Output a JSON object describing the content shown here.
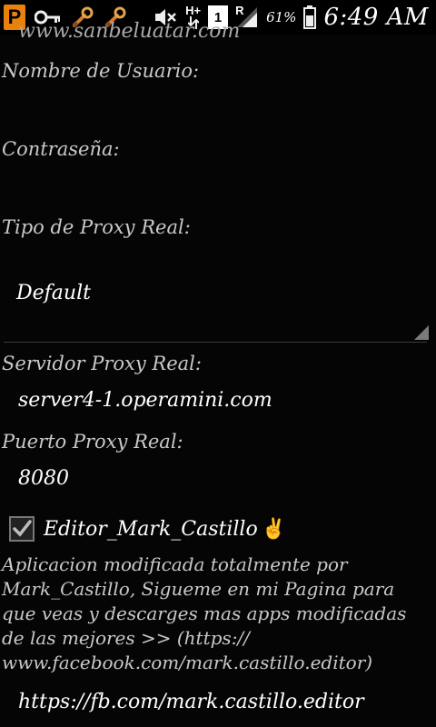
{
  "status_bar": {
    "app_badge": "P",
    "network_type": "H+",
    "sim_slot": "1",
    "roaming_indicator": "R",
    "battery_percent": "61%",
    "time": "6:49 AM",
    "icons": [
      "app-p-icon",
      "key-icon",
      "tool-icon",
      "tool-icon",
      "mute-icon",
      "hplus-signal-icon",
      "sim1-icon",
      "roaming-signal-icon",
      "battery-icon"
    ]
  },
  "form": {
    "top_cut_text": "www.sanbeluatar.com",
    "username_label": "Nombre de Usuario:",
    "username_value": "",
    "password_label": "Contraseña:",
    "password_value": "",
    "proxy_type_label": "Tipo de Proxy Real:",
    "proxy_type_value": "Default",
    "proxy_server_label": "Servidor Proxy Real:",
    "proxy_server_value": "server4-1.operamini.com",
    "proxy_port_label": "Puerto Proxy Real:",
    "proxy_port_value": "8080"
  },
  "editor_check": {
    "label": "Editor_Mark_Castillo",
    "emoji": "✌",
    "checked": true
  },
  "description": "Aplicacion modificada totalmente por Mark_Castillo, Sigueme en mi Pagina para que veas y descarges mas apps modificadas de las mejores >> (https:// www.facebook.com/mark.castillo.editor)",
  "link": "https://fb.com/mark.castillo.editor",
  "colors": {
    "background": "#050505",
    "label_text": "#c9c9c9",
    "value_text": "#ffffff",
    "app_badge": "#e8820c"
  }
}
